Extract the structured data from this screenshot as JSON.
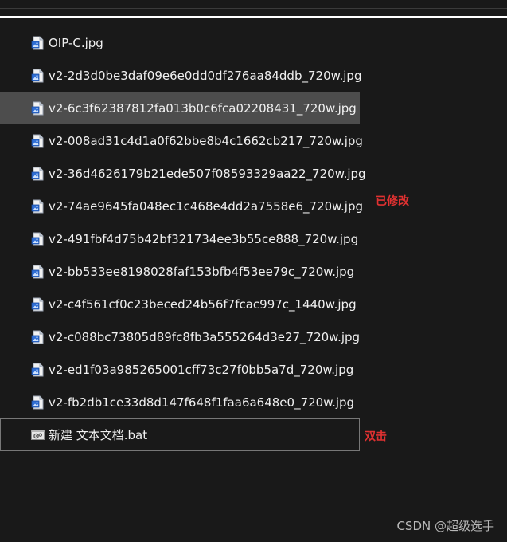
{
  "files": [
    {
      "name": "OIP-C.jpg",
      "type": "image",
      "icon": "image-file-icon"
    },
    {
      "name": "v2-2d3d0be3daf09e6e0dd0df276aa84ddb_720w.jpg",
      "type": "image",
      "icon": "image-file-icon"
    },
    {
      "name": "v2-6c3f62387812fa013b0c6fca02208431_720w.jpg",
      "type": "image",
      "icon": "image-file-icon",
      "selected": true
    },
    {
      "name": "v2-008ad31c4d1a0f62bbe8b4c1662cb217_720w.jpg",
      "type": "image",
      "icon": "image-file-icon"
    },
    {
      "name": "v2-36d4626179b21ede507f08593329aa22_720w.jpg",
      "type": "image",
      "icon": "image-file-icon"
    },
    {
      "name": "v2-74ae9645fa048ec1c468e4dd2a7558e6_720w.jpg",
      "type": "image",
      "icon": "image-file-icon"
    },
    {
      "name": "v2-491fbf4d75b42bf321734ee3b55ce888_720w.jpg",
      "type": "image",
      "icon": "image-file-icon"
    },
    {
      "name": "v2-bb533ee8198028faf153bfb4f53ee79c_720w.jpg",
      "type": "image",
      "icon": "image-file-icon"
    },
    {
      "name": "v2-c4f561cf0c23beced24b56f7fcac997c_1440w.jpg",
      "type": "image",
      "icon": "image-file-icon"
    },
    {
      "name": "v2-c088bc73805d89fc8fb3a555264d3e27_720w.jpg",
      "type": "image",
      "icon": "image-file-icon"
    },
    {
      "name": "v2-ed1f03a985265001cff73c27f0bb5a7d_720w.jpg",
      "type": "image",
      "icon": "image-file-icon"
    },
    {
      "name": "v2-fb2db1ce33d8d147f648f1faa6a648e0_720w.jpg",
      "type": "image",
      "icon": "image-file-icon"
    },
    {
      "name": "新建 文本文档.bat",
      "type": "batch",
      "icon": "batch-file-icon",
      "focused": true
    }
  ],
  "annotations": {
    "modified": "已修改",
    "double_click": "双击"
  },
  "annotation_color": "#e03131",
  "selected_row_color": "#4d4d4d",
  "background_color": "#191919",
  "watermark": "CSDN @超级选手"
}
